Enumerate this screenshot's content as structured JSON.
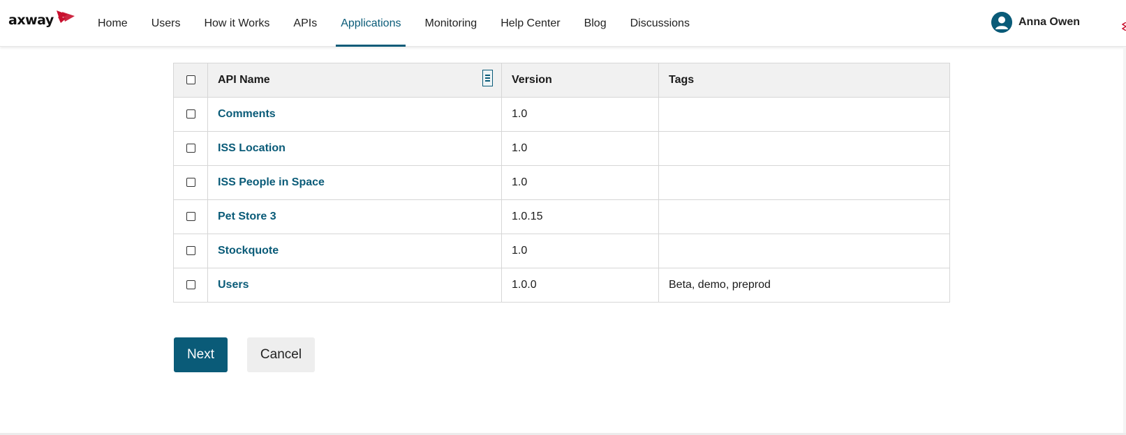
{
  "brand": {
    "name": "axway",
    "accent": "#c8102e"
  },
  "header": {
    "nav": [
      {
        "label": "Home",
        "active": false
      },
      {
        "label": "Users",
        "active": false
      },
      {
        "label": "How it Works",
        "active": false
      },
      {
        "label": "APIs",
        "active": false
      },
      {
        "label": "Applications",
        "active": true
      },
      {
        "label": "Monitoring",
        "active": false
      },
      {
        "label": "Help Center",
        "active": false
      },
      {
        "label": "Blog",
        "active": false
      },
      {
        "label": "Discussions",
        "active": false
      }
    ],
    "user": {
      "name": "Anna Owen",
      "icon": "user-avatar-icon"
    },
    "active_color": "#0a5b78"
  },
  "table": {
    "columns": {
      "name": "API Name",
      "version": "Version",
      "tags": "Tags"
    },
    "rows": [
      {
        "name": "Comments",
        "version": "1.0",
        "tags": ""
      },
      {
        "name": "ISS Location",
        "version": "1.0",
        "tags": ""
      },
      {
        "name": "ISS People in Space",
        "version": "1.0",
        "tags": ""
      },
      {
        "name": "Pet Store 3",
        "version": "1.0.15",
        "tags": ""
      },
      {
        "name": "Stockquote",
        "version": "1.0",
        "tags": ""
      },
      {
        "name": "Users",
        "version": "1.0.0",
        "tags": "Beta, demo, preprod"
      }
    ]
  },
  "actions": {
    "next_label": "Next",
    "cancel_label": "Cancel"
  }
}
